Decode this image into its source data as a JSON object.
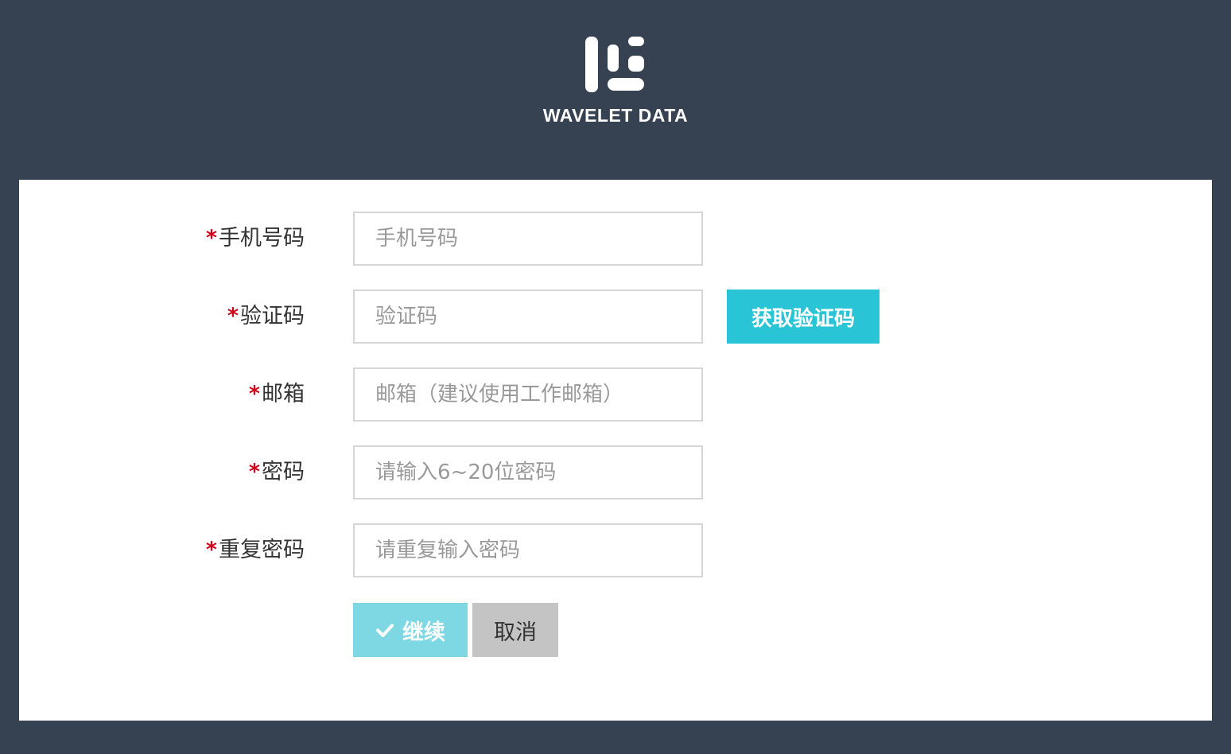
{
  "header": {
    "brand_name": "WAVELET DATA",
    "logo_icon": "wavelet-logo-icon"
  },
  "form": {
    "required_marker": "*",
    "fields": [
      {
        "label": "手机号码",
        "placeholder": "手机号码",
        "value": ""
      },
      {
        "label": "验证码",
        "placeholder": "验证码",
        "value": ""
      },
      {
        "label": "邮箱",
        "placeholder": "邮箱（建议使用工作邮箱）",
        "value": ""
      },
      {
        "label": "密码",
        "placeholder": "请输入6~20位密码",
        "value": ""
      },
      {
        "label": "重复密码",
        "placeholder": "请重复输入密码",
        "value": ""
      }
    ],
    "get_code_label": "获取验证码",
    "continue_label": "继续",
    "continue_icon": "check-icon",
    "cancel_label": "取消"
  },
  "colors": {
    "background": "#364152",
    "card": "#ffffff",
    "required": "#d0021b",
    "accent": "#29c5d6",
    "continue_button": "#7dd8e3",
    "cancel_button": "#c4c4c4"
  }
}
